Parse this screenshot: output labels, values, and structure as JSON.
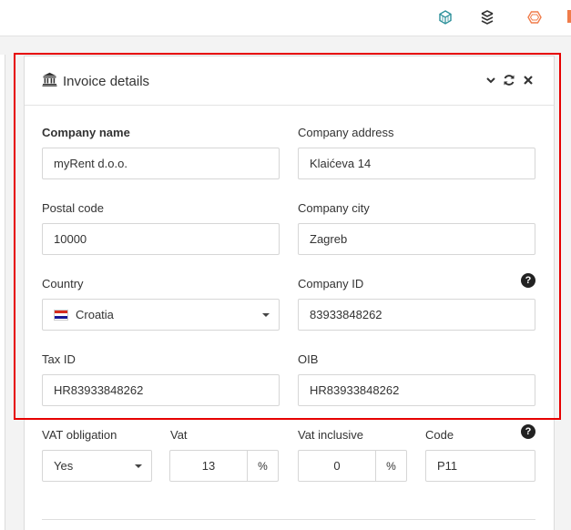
{
  "panel": {
    "title": "Invoice details"
  },
  "form": {
    "company_name": {
      "label": "Company name",
      "value": "myRent d.o.o."
    },
    "company_address": {
      "label": "Company address",
      "value": "Klaićeva 14"
    },
    "postal_code": {
      "label": "Postal code",
      "value": "10000"
    },
    "company_city": {
      "label": "Company city",
      "value": "Zagreb"
    },
    "country": {
      "label": "Country",
      "value": "Croatia"
    },
    "company_id": {
      "label": "Company ID",
      "value": "83933848262"
    },
    "tax_id": {
      "label": "Tax ID",
      "value": "HR83933848262"
    },
    "oib": {
      "label": "OIB",
      "value": "HR83933848262"
    },
    "vat_obligation": {
      "label": "VAT obligation",
      "value": "Yes"
    },
    "vat": {
      "label": "Vat",
      "value": "13",
      "suffix": "%"
    },
    "vat_inclusive": {
      "label": "Vat inclusive",
      "value": "0",
      "suffix": "%"
    },
    "code": {
      "label": "Code",
      "value": "P11"
    }
  },
  "help_glyph": "?",
  "colors": {
    "highlight": "#e60000",
    "toolbar_teal": "#2a8f99",
    "toolbar_orange": "#f07c4a"
  },
  "icons": {
    "toolbar": [
      "cube-icon",
      "layers-icon",
      "hexagon-icon"
    ],
    "header": [
      "bank-icon",
      "chevron-down-icon",
      "refresh-icon",
      "close-icon"
    ]
  }
}
